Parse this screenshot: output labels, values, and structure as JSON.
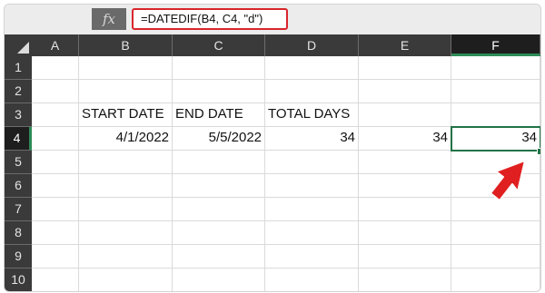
{
  "formula_bar": {
    "fx_label": "fx",
    "formula": "=DATEDIF(B4, C4, \"d\")"
  },
  "columns": [
    "A",
    "B",
    "C",
    "D",
    "E",
    "F"
  ],
  "rows": [
    "1",
    "2",
    "3",
    "4",
    "5",
    "6",
    "7",
    "8",
    "9",
    "10"
  ],
  "cells": {
    "B3": "START DATE",
    "C3": "END DATE",
    "D3": "TOTAL DAYS",
    "B4": "4/1/2022",
    "C4": "5/5/2022",
    "D4": "34",
    "E4": "34",
    "F4": "34"
  },
  "selected_cell": "F4",
  "colors": {
    "selection": "#217346",
    "highlight": "#d9262b",
    "arrow": "#e02020",
    "header_bg": "#3a3a3a"
  },
  "annotation": {
    "icon": "red-arrow-icon"
  }
}
